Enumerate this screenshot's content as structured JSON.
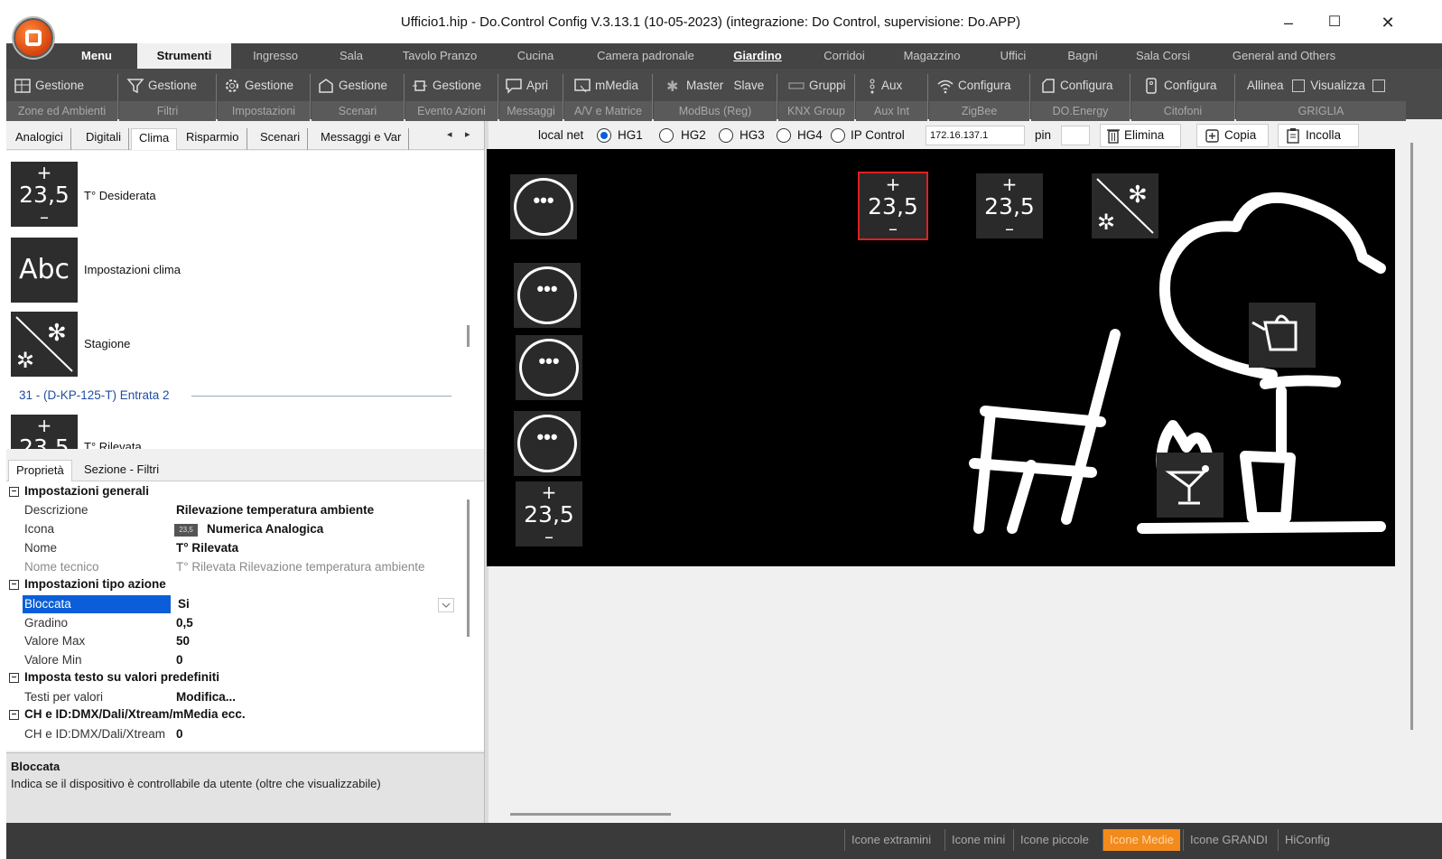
{
  "window": {
    "title": "Ufficio1.hip - Do.Control Config V.3.13.1 (10-05-2023) (integrazione: Do Control, supervisione: Do.APP)",
    "minimize": "–",
    "maximize": "☐",
    "close": "✕"
  },
  "menu_tabs": [
    "Menu",
    "Strumenti",
    "Ingresso",
    "Sala",
    "Tavolo Pranzo",
    "Cucina",
    "Camera padronale",
    "Giardino",
    "Corridoi",
    "Magazzino",
    "Uffici",
    "Bagni",
    "Sala Corsi",
    "General and Others"
  ],
  "toolbar": {
    "zone": {
      "label": "Gestione",
      "caption": "Zone ed Ambienti"
    },
    "filtri": {
      "label": "Gestione",
      "caption": "Filtri"
    },
    "impostazioni": {
      "label": "Gestione",
      "caption": "Impostazioni"
    },
    "scenari": {
      "label": "Gestione",
      "caption": "Scenari"
    },
    "evento": {
      "label": "Gestione",
      "caption": "Evento Azioni"
    },
    "messaggi": {
      "label": "Apri",
      "caption": "Messaggi"
    },
    "mmedia": {
      "label": "mMedia",
      "caption": "A/V e Matrice"
    },
    "modbus": {
      "label1": "Master",
      "label2": "Slave",
      "caption": "ModBus (Reg)"
    },
    "knx": {
      "label": "Gruppi",
      "caption": "KNX Group"
    },
    "aux": {
      "label": "Aux",
      "caption": "Aux Int"
    },
    "zigbee": {
      "label": "Configura",
      "caption": "ZigBee"
    },
    "energy": {
      "label": "Configura",
      "caption": "DO.Energy"
    },
    "citofoni": {
      "label": "Configura",
      "caption": "Citofoni"
    },
    "griglia": {
      "label1": "Allinea",
      "label2": "Visualizza",
      "caption": "GRIGLIA"
    }
  },
  "left_tabs": [
    "Analogici",
    "Digitali",
    "Clima",
    "Risparmio",
    "Scenari",
    "Messaggi e Var"
  ],
  "left_icons": [
    {
      "value": "23,5",
      "plus": "+",
      "minus": "–",
      "label": "T° Desiderata"
    },
    {
      "text": "Abc",
      "label": "Impostazioni clima"
    },
    {
      "label": "Stagione"
    },
    {
      "value": "23,5",
      "plus": "+",
      "minus": "–",
      "label": "T° Rilevata"
    }
  ],
  "group_header": "31 - (D-KP-125-T) Entrata 2",
  "props_tabs": [
    "Proprietà",
    "Sezione - Filtri"
  ],
  "props": {
    "sec1": "Impostazioni generali",
    "descrizione": {
      "k": "Descrizione",
      "v": "Rilevazione temperatura ambiente"
    },
    "icona": {
      "k": "Icona",
      "v": "Numerica Analogica",
      "thumb": "23,5"
    },
    "nome": {
      "k": "Nome",
      "v": "T° Rilevata"
    },
    "nome_tecnico": {
      "k": "Nome tecnico",
      "v": "T° Rilevata Rilevazione temperatura ambiente"
    },
    "sec2": "Impostazioni tipo azione",
    "bloccata": {
      "k": "Bloccata",
      "v": "Si"
    },
    "gradino": {
      "k": "Gradino",
      "v": "0,5"
    },
    "valore_max": {
      "k": "Valore Max",
      "v": "50"
    },
    "valore_min": {
      "k": "Valore Min",
      "v": "0"
    },
    "sec3": "Imposta testo su valori predefiniti",
    "testi": {
      "k": "Testi per valori",
      "v": "Modifica..."
    },
    "sec4": "CH e ID:DMX/Dali/Xtream/mMedia ecc.",
    "ch": {
      "k": "CH e ID:DMX/Dali/Xtream",
      "v": "0"
    }
  },
  "help": {
    "title": "Bloccata",
    "desc": "Indica se il dispositivo è controllabile da utente (oltre che visualizzabile)"
  },
  "ctrl": {
    "localnet": "local net",
    "radios": [
      "HG1",
      "HG2",
      "HG3",
      "HG4",
      "IP Control"
    ],
    "selected": "HG1",
    "ip": "172.16.137.1",
    "pin_label": "pin",
    "elimina": "Elimina",
    "copia": "Copia",
    "incolla": "Incolla"
  },
  "canvas_tiles": {
    "dots": "•••",
    "value": "23,5",
    "plus": "+",
    "minus": "–"
  },
  "statusbar": [
    "Icone extramini",
    "Icone mini",
    "Icone piccole",
    "Icone Medie",
    "Icone GRANDI",
    "HiConfig"
  ],
  "status_active": "Icone Medie",
  "colors": {
    "accent": "#0b5ed7",
    "selection_border": "#e02020",
    "status_active": "#f38a1c",
    "canvas_bg": "#000000"
  }
}
